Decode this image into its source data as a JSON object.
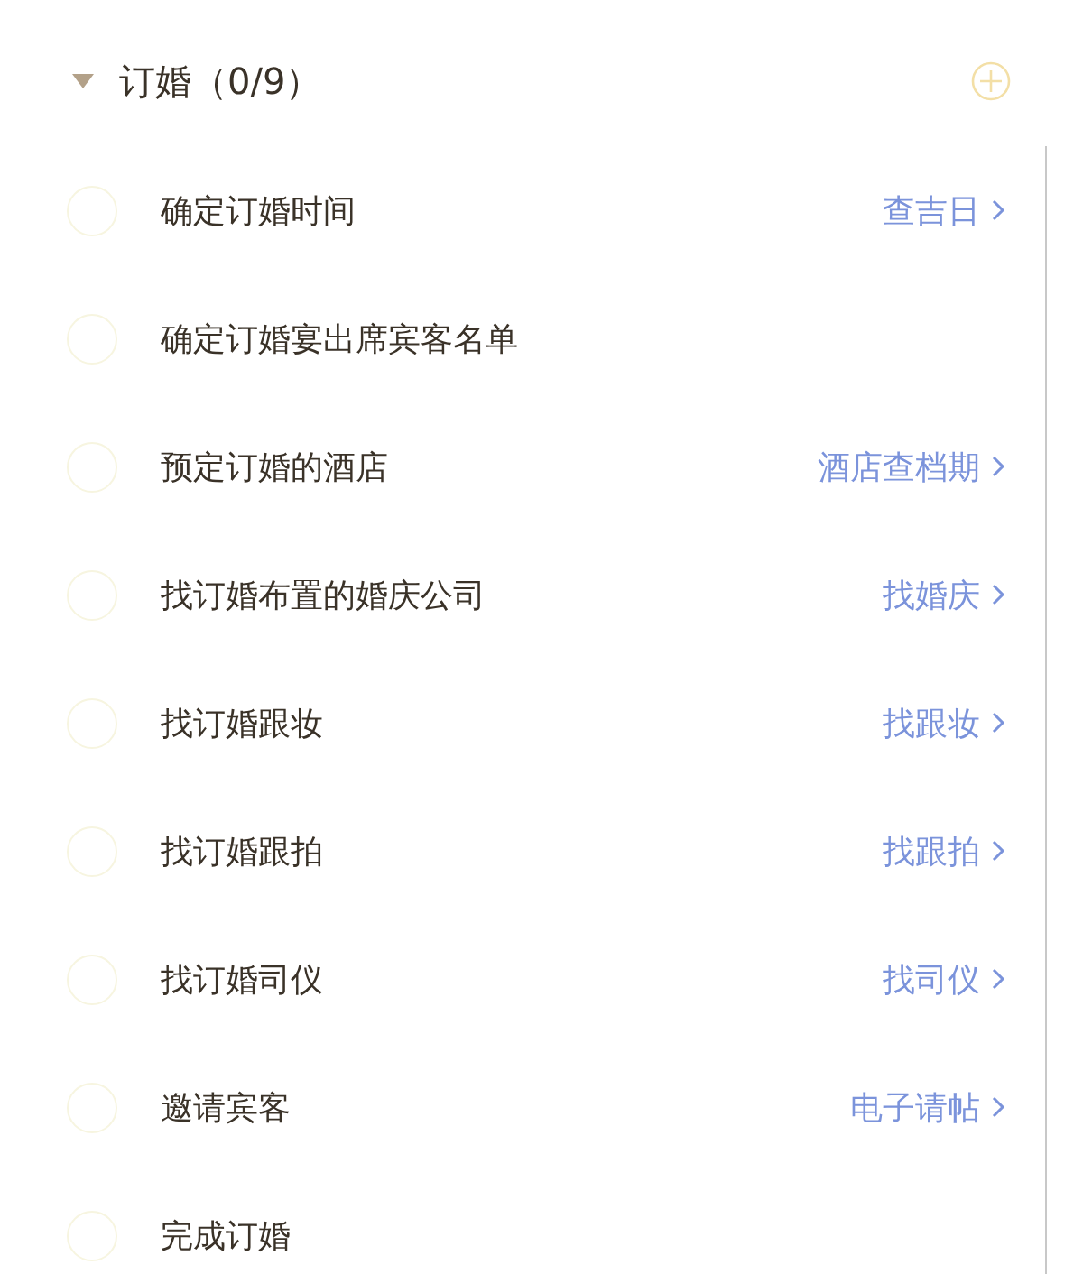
{
  "section": {
    "title": "订婚（0/9）",
    "expanded": true
  },
  "tasks": [
    {
      "label": "确定订婚时间",
      "checked": false,
      "link": "查吉日"
    },
    {
      "label": "确定订婚宴出席宾客名单",
      "checked": false
    },
    {
      "label": "预定订婚的酒店",
      "checked": false,
      "link": "酒店查档期"
    },
    {
      "label": "找订婚布置的婚庆公司",
      "checked": false,
      "link": "找婚庆"
    },
    {
      "label": "找订婚跟妆",
      "checked": false,
      "link": "找跟妆"
    },
    {
      "label": "找订婚跟拍",
      "checked": false,
      "link": "找跟拍"
    },
    {
      "label": "找订婚司仪",
      "checked": false,
      "link": "找司仪"
    },
    {
      "label": "邀请宾客",
      "checked": false,
      "link": "电子请帖"
    },
    {
      "label": "完成订婚",
      "checked": false
    }
  ]
}
